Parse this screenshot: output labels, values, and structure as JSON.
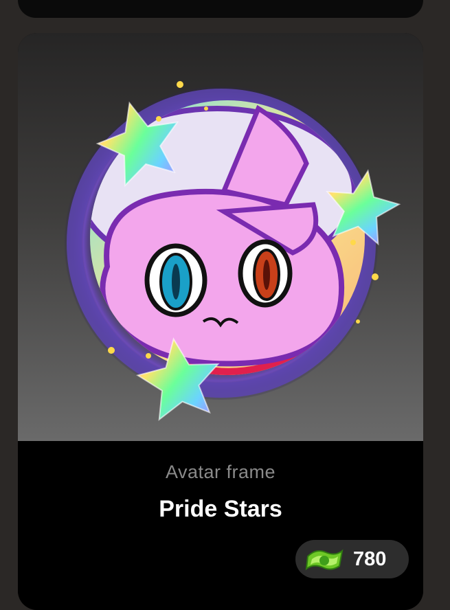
{
  "item": {
    "category": "Avatar frame",
    "name": "Pride Stars",
    "price": "780",
    "currency_icon": "coins-icon",
    "preview_icon": "avatar-frame-preview"
  },
  "colors": {
    "card": "#000000",
    "background": "#2b2826",
    "price_pill": "#2d2d2d",
    "frame_ring": "#6b4ab8",
    "avatar_pink": "#f3a6ec"
  }
}
